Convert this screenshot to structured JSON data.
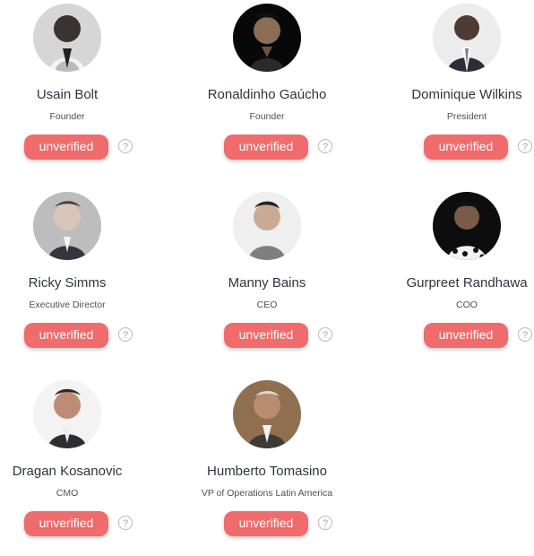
{
  "status_label": "unverified",
  "help_glyph": "?",
  "colors": {
    "badge": "#ef6b6c",
    "name": "#2f3440",
    "role": "#4b4f58",
    "help": "#a8a8a8"
  },
  "people": [
    {
      "name": "Usain Bolt",
      "role": "Founder",
      "avatar_style": "dark-skin-white-shirt"
    },
    {
      "name": "Ronaldinho Gaúcho",
      "role": "Founder",
      "avatar_style": "black-background-dark-shirt"
    },
    {
      "name": "Dominique Wilkins",
      "role": "President",
      "avatar_style": "suit-and-tie"
    },
    {
      "name": "Ricky Simms",
      "role": "Executive Director",
      "avatar_style": "dark-suit"
    },
    {
      "name": "Manny Bains",
      "role": "CEO",
      "avatar_style": "grey-tshirt"
    },
    {
      "name": "Gurpreet Randhawa",
      "role": "COO",
      "avatar_style": "black-dot-shirt"
    },
    {
      "name": "Dragan Kosanovic",
      "role": "CMO",
      "avatar_style": "dark-jacket"
    },
    {
      "name": "Humberto Tomasino",
      "role": "VP of Operations Latin America",
      "avatar_style": "warm-background-jacket"
    }
  ]
}
